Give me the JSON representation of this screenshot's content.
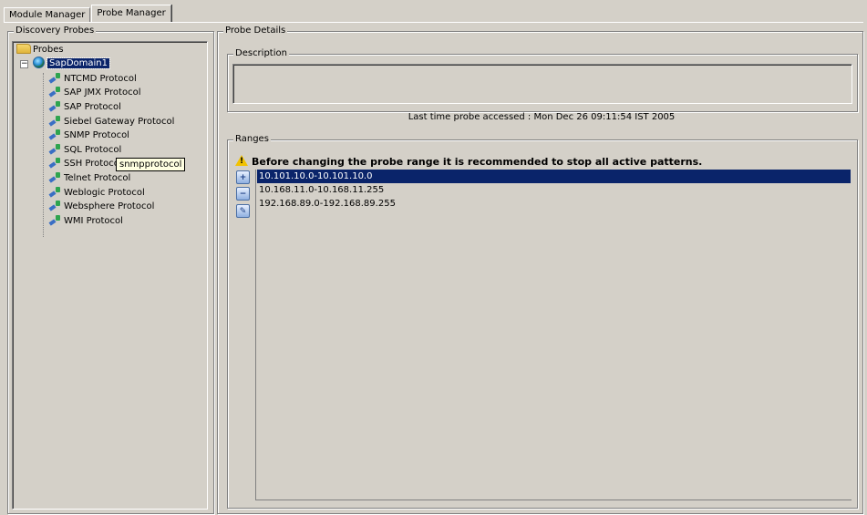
{
  "tabs": [
    {
      "label": "Module Manager",
      "active": false
    },
    {
      "label": "Probe Manager",
      "active": true
    }
  ],
  "left_panel": {
    "title": "Discovery Probes",
    "root": "Probes",
    "domain": "SapDomain1",
    "protocols": [
      "NTCMD Protocol",
      "SAP JMX Protocol",
      "SAP Protocol",
      "Siebel Gateway Protocol",
      "SNMP Protocol",
      "SQL Protocol",
      "SSH Protocol",
      "Telnet Protocol",
      "Weblogic Protocol",
      "Websphere Protocol",
      "WMI Protocol"
    ],
    "tooltip": "snmpprotocol"
  },
  "right_panel": {
    "title": "Probe Details",
    "description": {
      "title": "Description",
      "value": ""
    },
    "last_accessed": "Last time probe accessed : Mon Dec 26 09:11:54 IST 2005",
    "ranges": {
      "title": "Ranges",
      "warning": "Before changing the probe range it is recommended to stop all active patterns.",
      "items": [
        "10.101.10.0-10.101.10.0",
        "10.168.11.0-10.168.11.255",
        "192.168.89.0-192.168.89.255"
      ],
      "selected_index": 0
    }
  },
  "icons": {
    "add": "add-range-icon",
    "remove": "remove-range-icon",
    "edit": "edit-range-icon"
  },
  "colors": {
    "selection": "#0a246a",
    "background": "#d4d0c8"
  }
}
